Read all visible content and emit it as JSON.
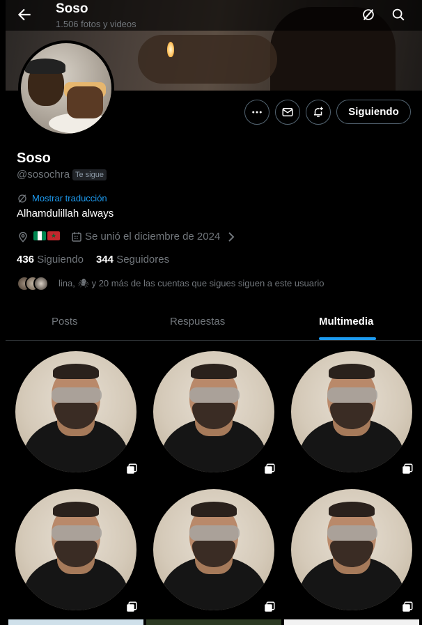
{
  "header": {
    "title": "Soso",
    "subtitle": "1.506 fotos y videos"
  },
  "profile": {
    "name": "Soso",
    "handle": "@sosochra",
    "follows_you_badge": "Te sigue",
    "translate_link": "Mostrar traducción",
    "bio": "Alhamdulillah always",
    "location_flags": [
      "nigeria-flag",
      "morocco-flag"
    ],
    "joined": "Se unió el diciembre de 2024",
    "following_count": "436",
    "following_label": "Siguiendo",
    "followers_count": "344",
    "followers_label": "Seguidores",
    "followed_by_text": "lina, 🕷 y 20 más de las cuentas que sigues siguen a este usuario"
  },
  "actions": {
    "more": "more-icon",
    "message": "envelope-icon",
    "notify": "bell-plus-icon",
    "follow_label": "Siguiendo"
  },
  "tabs": [
    {
      "label": "Posts"
    },
    {
      "label": "Respuestas"
    },
    {
      "label": "Multimedia",
      "active": true
    }
  ],
  "colors": {
    "accent": "#1d9bf0",
    "background": "#000000",
    "muted": "#71767b"
  },
  "media_grid": {
    "rows": 2,
    "columns": 3,
    "item_icon": "multiple-images-icon"
  }
}
